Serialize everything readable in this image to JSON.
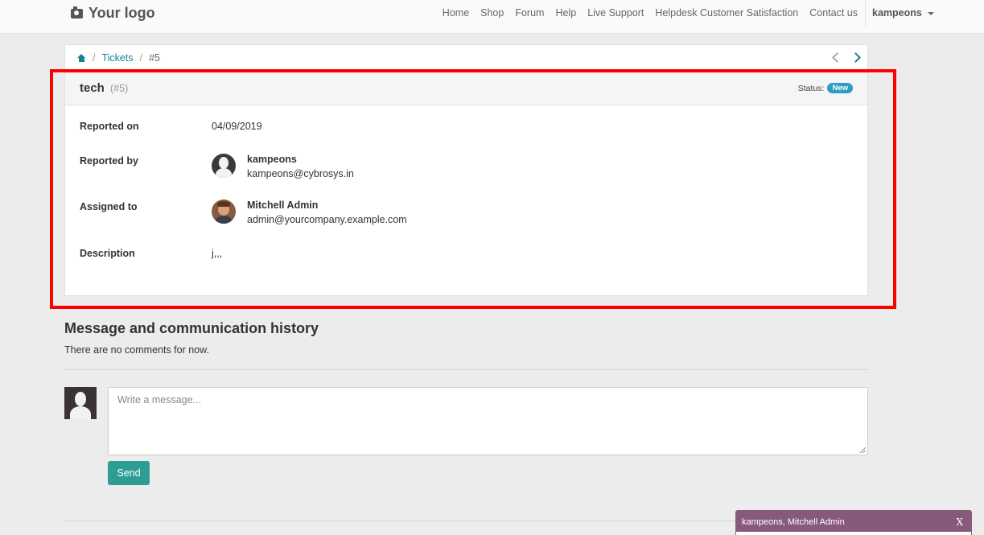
{
  "header": {
    "logo": "Your logo",
    "nav": [
      "Home",
      "Shop",
      "Forum",
      "Help",
      "Live Support",
      "Helpdesk Customer Satisfaction",
      "Contact us"
    ],
    "user": "kampeons"
  },
  "breadcrumb": {
    "tickets": "Tickets",
    "current": "#5"
  },
  "ticket": {
    "name": "tech",
    "id": "(#5)",
    "status_label": "Status:",
    "status": "New",
    "status_color": "#2e9ec0",
    "reported_on_label": "Reported on",
    "reported_on": "04/09/2019",
    "reported_by_label": "Reported by",
    "reporter_name": "kampeons",
    "reporter_email": "kampeons@cybrosys.in",
    "assigned_to_label": "Assigned to",
    "assignee_name": "Mitchell Admin",
    "assignee_email": "admin@yourcompany.example.com",
    "description_label": "Description",
    "description": "j,,,"
  },
  "messages": {
    "title": "Message and communication history",
    "empty": "There are no comments for now.",
    "placeholder": "Write a message...",
    "send": "Send"
  },
  "chat": {
    "title": "kampeons, Mitchell Admin",
    "close": "X",
    "color": "#875a7b"
  },
  "highlight_color": "#ff0000",
  "accent": "#17828e"
}
